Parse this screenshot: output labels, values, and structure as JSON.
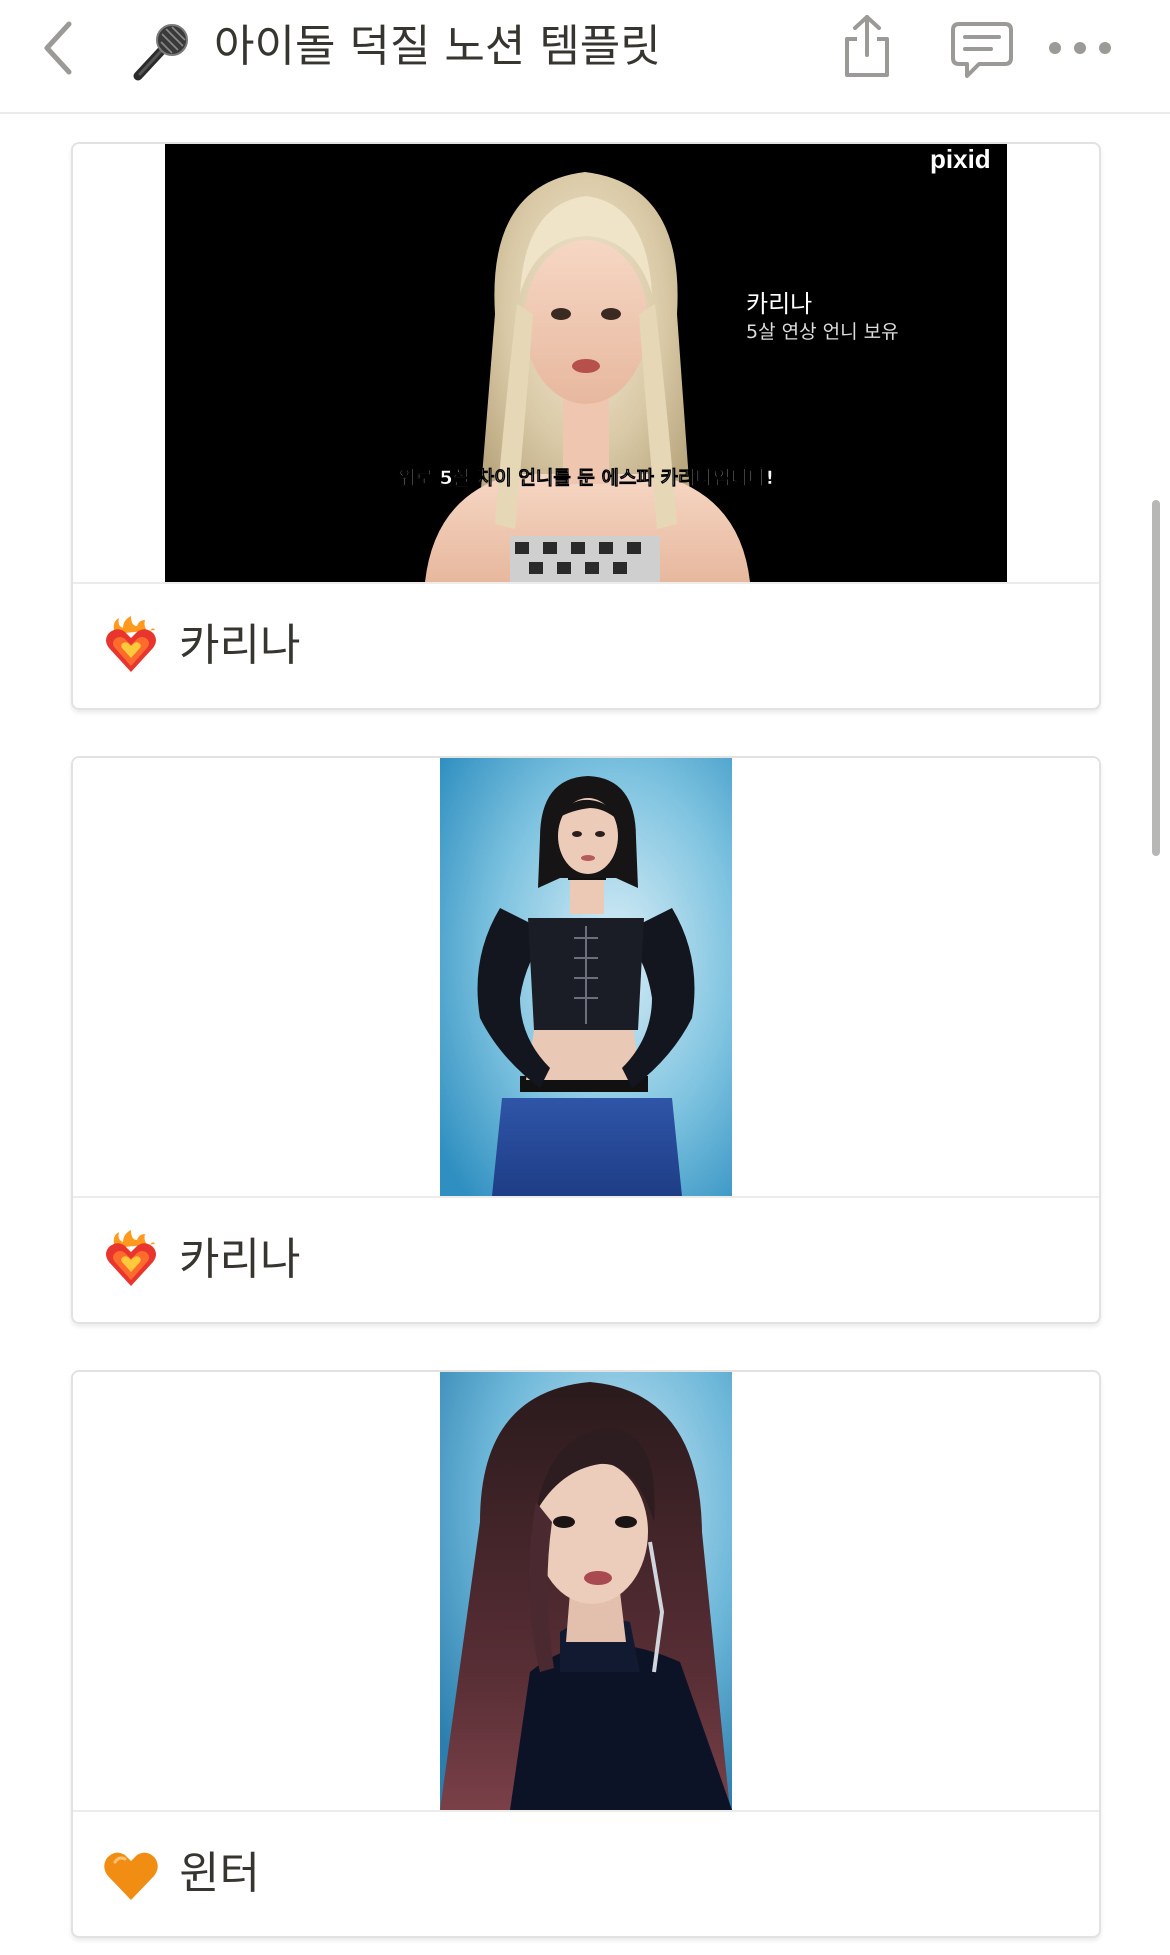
{
  "page": {
    "title": "아이돌 덕질 노션 템플릿",
    "icon": "microphone-emoji"
  },
  "toolbar": {
    "back_icon": "chevron-left-icon",
    "share_icon": "share-icon",
    "comments_icon": "comment-icon",
    "more_icon": "more-horizontal-icon"
  },
  "cards": [
    {
      "name": "카리나",
      "emoji": "heart-on-fire-emoji",
      "cover": {
        "kind": "video-still",
        "watermark": "pixid",
        "caption_name": "카리나",
        "caption_sub": "5살 연상 언니 보유",
        "subtitle": "위로 5살 차이 언니를 둔 에스파 카리나입니다!"
      }
    },
    {
      "name": "카리나",
      "emoji": "heart-on-fire-emoji",
      "cover": {
        "kind": "portrait-photo"
      }
    },
    {
      "name": "윈터",
      "emoji": "orange-heart-emoji",
      "cover": {
        "kind": "portrait-photo"
      }
    }
  ],
  "colors": {
    "text": "#37352f",
    "icon_gray": "#9b9a97",
    "border": "#e3e2e0",
    "fire_heart": "#e8352d",
    "orange_heart": "#f28d14"
  }
}
